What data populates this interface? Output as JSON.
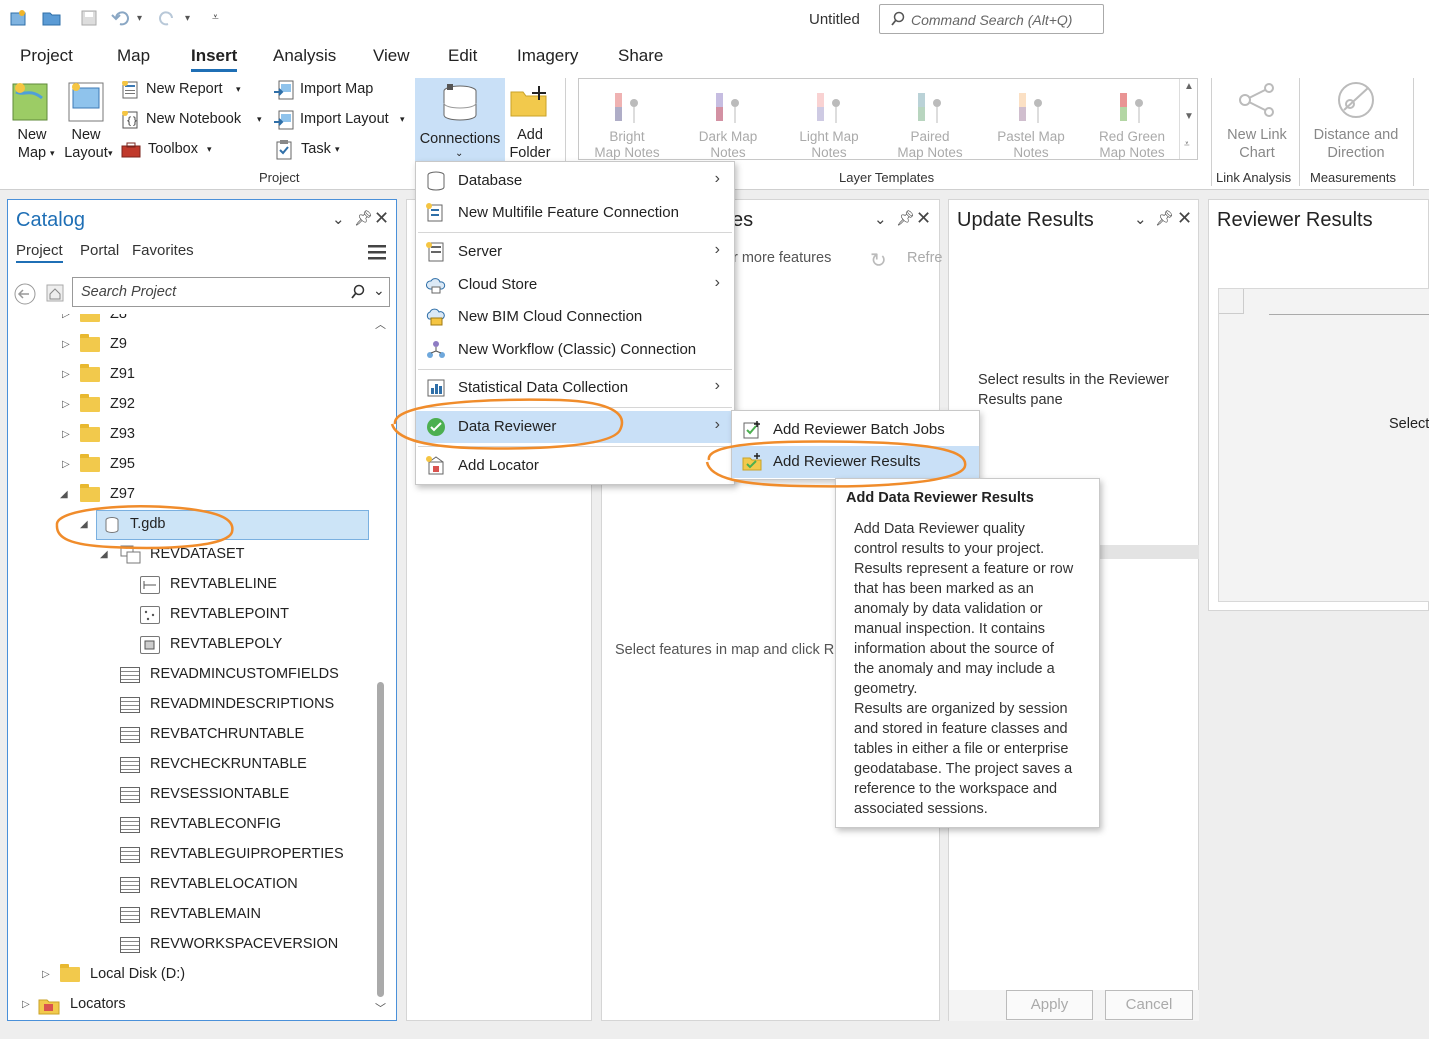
{
  "titlebar": {
    "document_title": "Untitled",
    "command_search_placeholder": "Command Search (Alt+Q)",
    "qat_icons": [
      "new-project-icon",
      "open-project-icon",
      "save-icon",
      "undo-icon",
      "redo-icon",
      "customize-icon"
    ]
  },
  "tabs": [
    "Project",
    "Map",
    "Insert",
    "Analysis",
    "View",
    "Edit",
    "Imagery",
    "Share"
  ],
  "active_tab": "Insert",
  "ribbon": {
    "project_group": {
      "new_map": "New",
      "new_map2": "Map",
      "new_layout": "New",
      "new_layout2": "Layout",
      "new_report": "New Report",
      "new_notebook": "New Notebook",
      "toolbox": "Toolbox",
      "import_map": "Import Map",
      "import_layout": "Import Layout",
      "task": "Task",
      "connections": "Connections",
      "add_folder": "Add",
      "add_folder2": "Folder",
      "group_label": "Project"
    },
    "layer_templates": {
      "items": [
        {
          "line1": "Bright",
          "line2": "Map Notes"
        },
        {
          "line1": "Dark Map",
          "line2": "Notes"
        },
        {
          "line1": "Light Map",
          "line2": "Notes"
        },
        {
          "line1": "Paired",
          "line2": "Map Notes"
        },
        {
          "line1": "Pastel Map",
          "line2": "Notes"
        },
        {
          "line1": "Red Green",
          "line2": "Map Notes"
        }
      ],
      "group_label": "Layer Templates"
    },
    "link_analysis": {
      "btn1": "New Link",
      "btn2": "Chart",
      "group_label": "Link Analysis"
    },
    "measurements": {
      "btn1": "Distance and",
      "btn2": "Direction",
      "group_label": "Measurements"
    }
  },
  "catalog": {
    "title": "Catalog",
    "subtabs": [
      "Project",
      "Portal",
      "Favorites"
    ],
    "search_placeholder": "Search Project",
    "tree": [
      {
        "label": "Z8",
        "kind": "folder"
      },
      {
        "label": "Z9",
        "kind": "folder"
      },
      {
        "label": "Z91",
        "kind": "folder"
      },
      {
        "label": "Z92",
        "kind": "folder"
      },
      {
        "label": "Z93",
        "kind": "folder"
      },
      {
        "label": "Z95",
        "kind": "folder"
      },
      {
        "label": "Z97",
        "kind": "folder"
      },
      {
        "label": "T.gdb",
        "kind": "gdb"
      },
      {
        "label": "REVDATASET",
        "kind": "dataset"
      },
      {
        "label": "REVTABLELINE",
        "kind": "fc"
      },
      {
        "label": "REVTABLEPOINT",
        "kind": "fc"
      },
      {
        "label": "REVTABLEPOLY",
        "kind": "fc"
      },
      {
        "label": "REVADMINCUSTOMFIELDS",
        "kind": "table"
      },
      {
        "label": "REVADMINDESCRIPTIONS",
        "kind": "table"
      },
      {
        "label": "REVBATCHRUNTABLE",
        "kind": "table"
      },
      {
        "label": "REVCHECKRUNTABLE",
        "kind": "table"
      },
      {
        "label": "REVSESSIONTABLE",
        "kind": "table"
      },
      {
        "label": "REVTABLECONFIG",
        "kind": "table"
      },
      {
        "label": "REVTABLEGUIPROPERTIES",
        "kind": "table"
      },
      {
        "label": "REVTABLELOCATION",
        "kind": "table"
      },
      {
        "label": "REVTABLEMAIN",
        "kind": "table"
      },
      {
        "label": "REVWORKSPACEVERSION",
        "kind": "table"
      },
      {
        "label": "Local Disk (D:)",
        "kind": "folder"
      },
      {
        "label": "Locators",
        "kind": "locator"
      }
    ]
  },
  "features_pane": {
    "title_fragment": "es",
    "hint_fragment": "r more features",
    "refresh_fragment": "Refre",
    "body_fragment": "Select features in map and click R"
  },
  "update_results": {
    "title": "Update Results",
    "message_line1": "Select results in the Reviewer",
    "message_line2": "Results pane",
    "apply": "Apply",
    "cancel": "Cancel"
  },
  "reviewer_results": {
    "title": "Reviewer Results",
    "select_fragment": "Select"
  },
  "connections_menu": {
    "items": [
      {
        "label": "Database",
        "icon": "database-icon",
        "submenu": true
      },
      {
        "label": "New Multifile Feature Connection",
        "icon": "multifile-icon",
        "submenu": false
      },
      {
        "label": "Server",
        "icon": "server-icon",
        "submenu": true
      },
      {
        "label": "Cloud Store",
        "icon": "cloud-store-icon",
        "submenu": true
      },
      {
        "label": "New BIM Cloud Connection",
        "icon": "bim-cloud-icon",
        "submenu": false
      },
      {
        "label": "New Workflow (Classic) Connection",
        "icon": "workflow-icon",
        "submenu": false
      },
      {
        "label": "Statistical Data Collection",
        "icon": "statistics-icon",
        "submenu": true
      },
      {
        "label": "Data Reviewer",
        "icon": "check-circle-icon",
        "submenu": true
      },
      {
        "label": "Add Locator",
        "icon": "locator-icon",
        "submenu": false
      }
    ]
  },
  "data_reviewer_submenu": {
    "items": [
      "Add Reviewer Batch Jobs",
      "Add Reviewer Results"
    ]
  },
  "tooltip": {
    "title": "Add Data Reviewer Results",
    "body_lines": [
      "Add Data Reviewer quality",
      "control results to your project.",
      "Results represent a feature or row",
      "that has been marked as an",
      "anomaly by data validation or",
      "manual inspection.  It contains",
      "information about the source of",
      "the anomaly and may include a",
      "geometry.",
      "Results are organized by session",
      "and stored in feature classes and",
      "tables in either a file or enterprise",
      "geodatabase.  The project saves a",
      "reference to the workspace and",
      "associated sessions."
    ]
  },
  "colors": {
    "accent": "#1f6fb5",
    "highlight": "#c9e0f7",
    "annotation": "#f08c2b",
    "folder": "#f2c94c"
  }
}
